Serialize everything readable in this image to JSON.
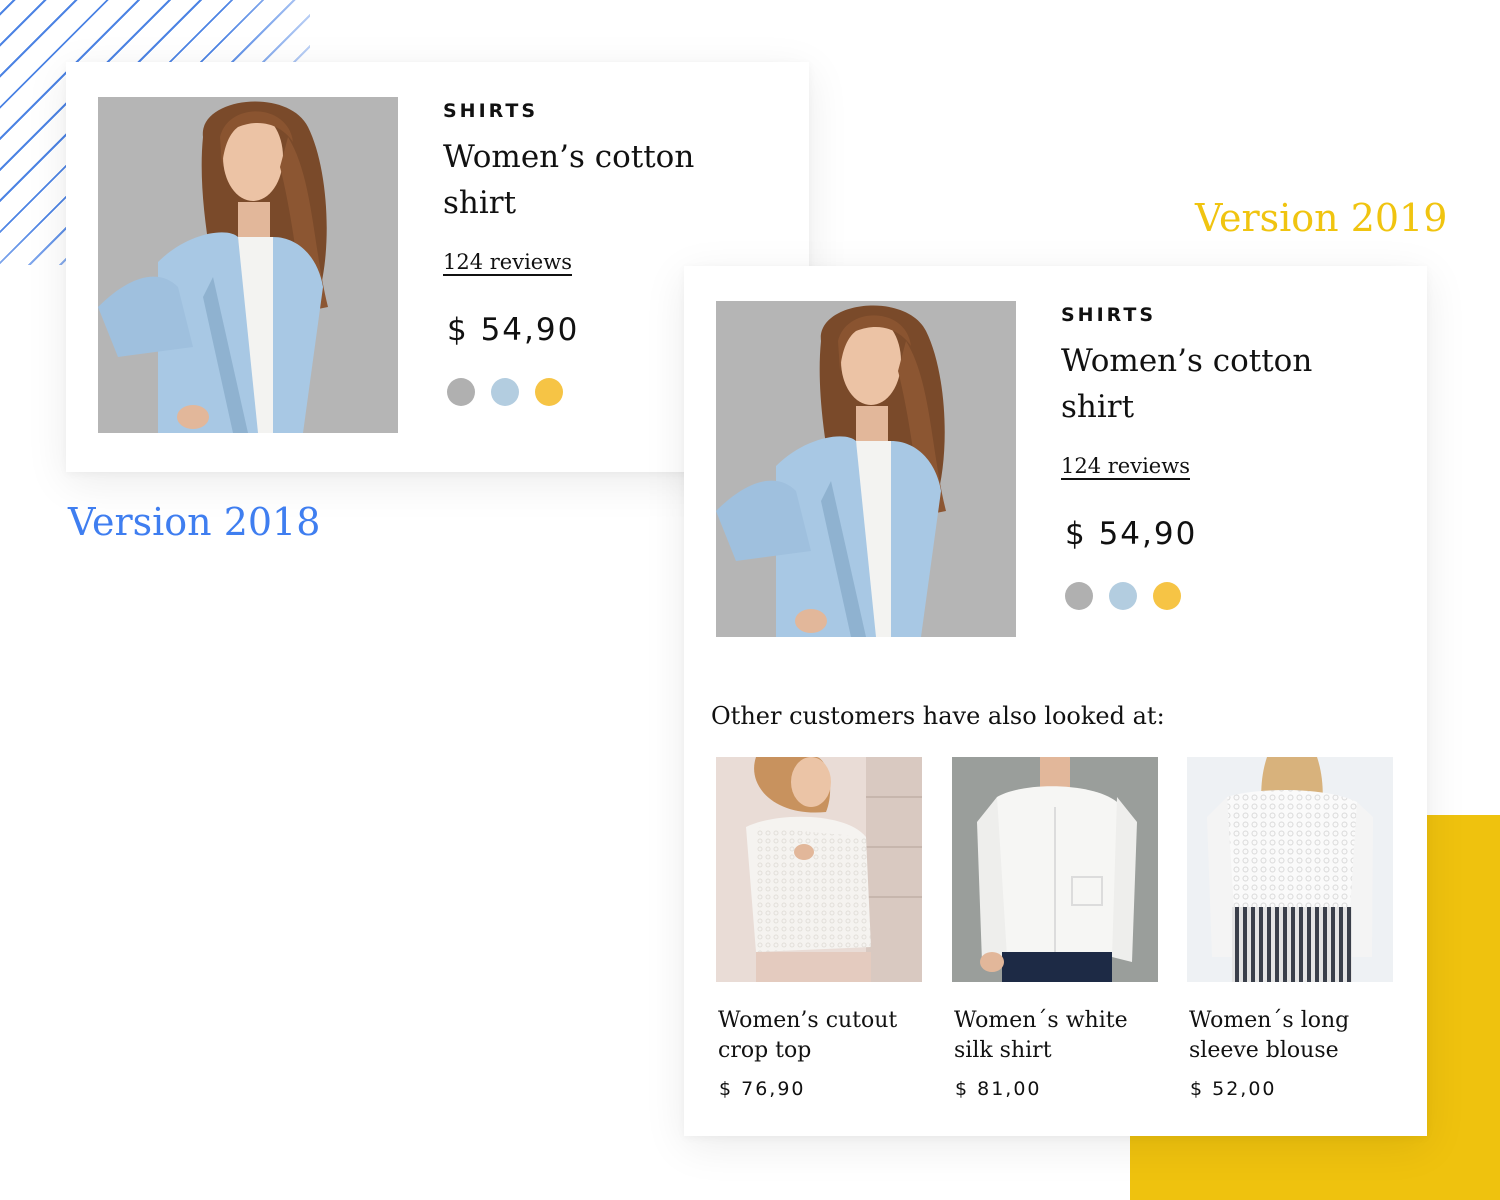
{
  "colors": {
    "accent_2018": "#3f7ef0",
    "accent_2019": "#f0c410",
    "yellow_block": "#efc20e",
    "swatch_gray": "#b0b0b0",
    "swatch_blue": "#b3cde0",
    "swatch_yellow": "#f6c445"
  },
  "version_2018": {
    "label": "Version 2018",
    "product": {
      "category": "SHIRTS",
      "title": "Women’s cotton shirt",
      "reviews": "124 reviews",
      "price": "$ 54,90",
      "swatches": [
        "gray",
        "light-blue",
        "yellow"
      ]
    }
  },
  "version_2019": {
    "label": "Version 2019",
    "product": {
      "category": "SHIRTS",
      "title": "Women’s cotton shirt",
      "reviews": "124 reviews",
      "price": "$ 54,90",
      "swatches": [
        "gray",
        "light-blue",
        "yellow"
      ]
    },
    "recommendations": {
      "heading": "Other customers have also looked at:",
      "items": [
        {
          "title": "Women’s cutout crop top",
          "price": "$ 76,90"
        },
        {
          "title": "Women´s white silk shirt",
          "price": "$ 81,00"
        },
        {
          "title": "Women´s long sleeve blouse",
          "price": "$ 52,00"
        }
      ]
    }
  }
}
